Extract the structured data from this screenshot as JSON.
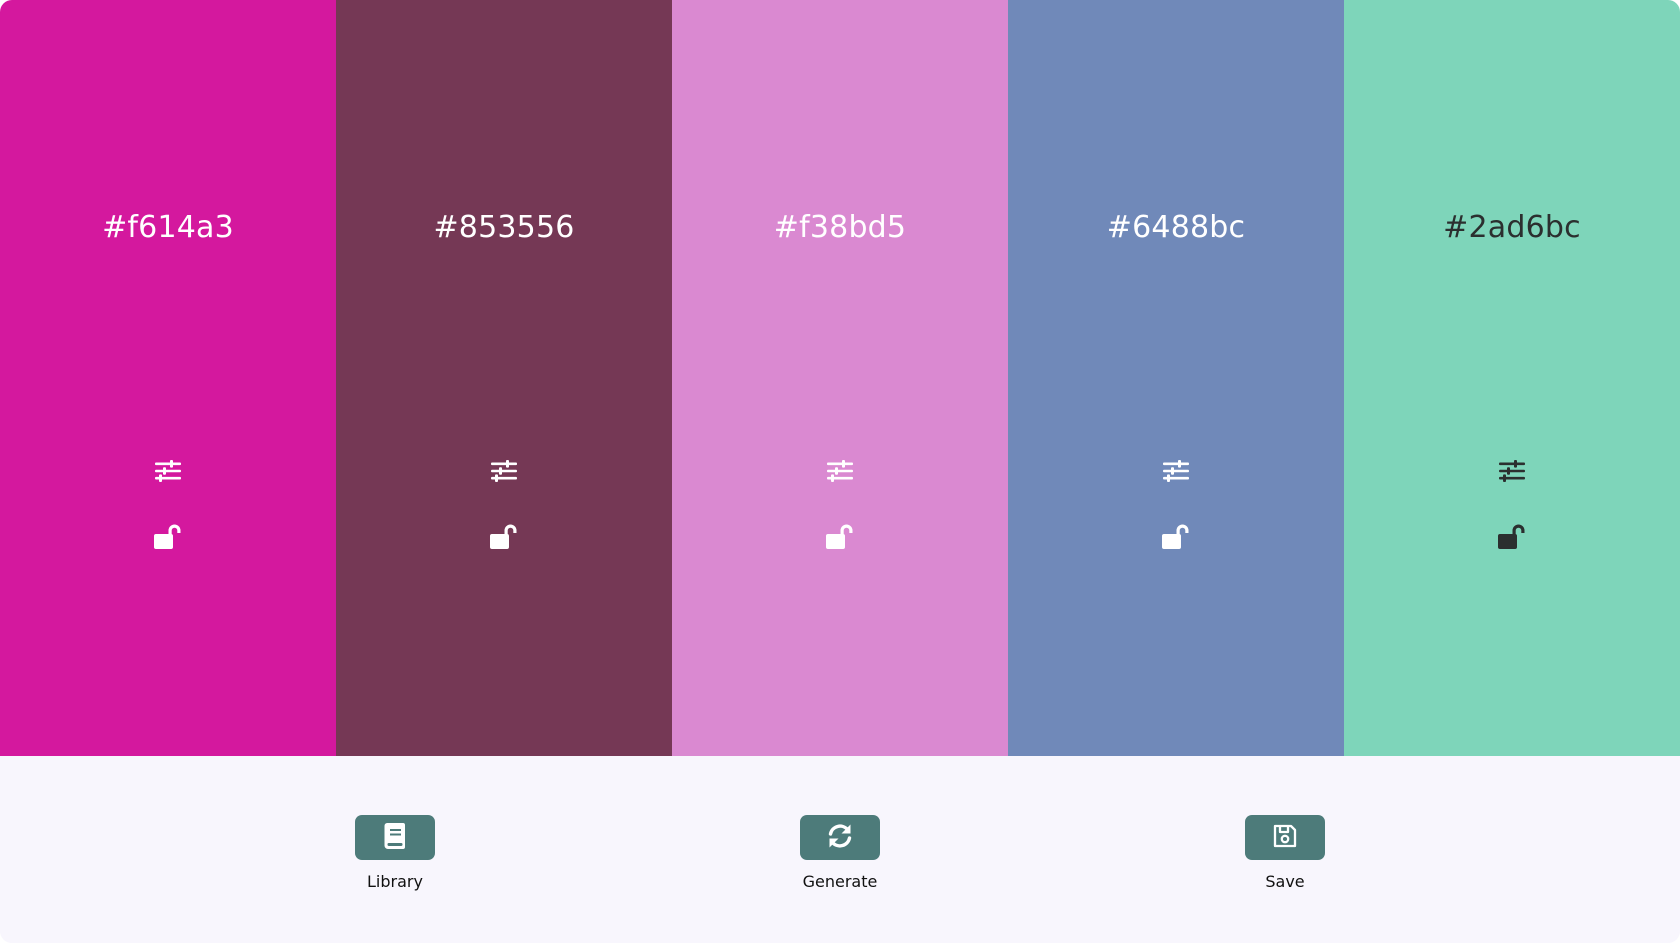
{
  "palette": {
    "swatches": [
      {
        "hex": "#f614a3",
        "background": "#d4189e",
        "foreground": "#ffffff",
        "locked": false
      },
      {
        "hex": "#853556",
        "background": "#753855",
        "foreground": "#ffffff",
        "locked": false
      },
      {
        "hex": "#f38bd5",
        "background": "#da89d1",
        "foreground": "#ffffff",
        "locked": false
      },
      {
        "hex": "#6488bc",
        "background": "#7089b9",
        "foreground": "#ffffff",
        "locked": false
      },
      {
        "hex": "#2ad6bc",
        "background": "#7ed5ba",
        "foreground": "#2b2f2f",
        "locked": false
      }
    ],
    "icons": {
      "adjust": "sliders-icon",
      "lock": "unlock-icon"
    }
  },
  "controls": {
    "library_label": "Library",
    "generate_label": "Generate",
    "save_label": "Save",
    "button_color": "#4d7b7a",
    "icons": {
      "library": "book-icon",
      "generate": "refresh-icon",
      "save": "floppy-disk-icon"
    }
  }
}
